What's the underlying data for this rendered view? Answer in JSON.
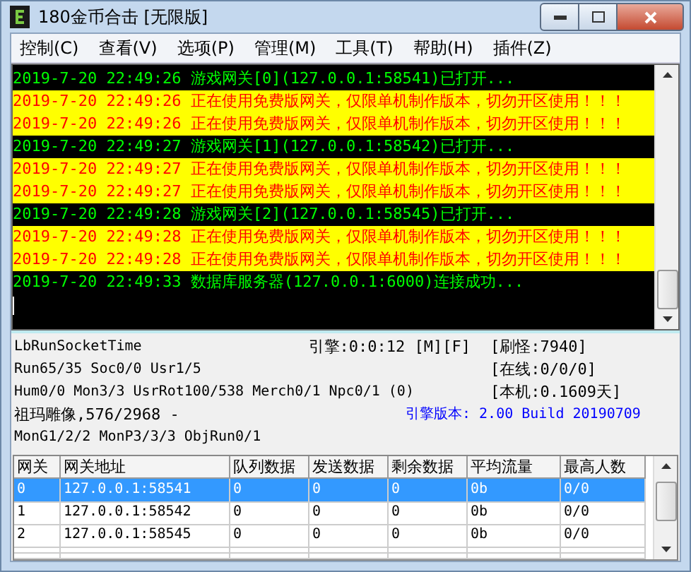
{
  "window": {
    "title": "180金币合击 [无限版]"
  },
  "menu": [
    "控制(C)",
    "查看(V)",
    "选项(P)",
    "管理(M)",
    "工具(T)",
    "帮助(H)",
    "插件(Z)"
  ],
  "log": [
    {
      "kind": "info",
      "text": "2019-7-20 22:49:26 游戏网关[0](127.0.0.1:58541)已打开..."
    },
    {
      "kind": "warning",
      "text": "2019-7-20 22:49:26 正在使用免费版网关，仅限单机制作版本，切勿开区使用！！！"
    },
    {
      "kind": "warning",
      "text": "2019-7-20 22:49:26 正在使用免费版网关，仅限单机制作版本，切勿开区使用！！！"
    },
    {
      "kind": "info",
      "text": "2019-7-20 22:49:27 游戏网关[1](127.0.0.1:58542)已打开..."
    },
    {
      "kind": "warning",
      "text": "2019-7-20 22:49:27 正在使用免费版网关，仅限单机制作版本，切勿开区使用！！！"
    },
    {
      "kind": "warning",
      "text": "2019-7-20 22:49:27 正在使用免费版网关，仅限单机制作版本，切勿开区使用！！！"
    },
    {
      "kind": "info",
      "text": "2019-7-20 22:49:28 游戏网关[2](127.0.0.1:58545)已打开..."
    },
    {
      "kind": "warning",
      "text": "2019-7-20 22:49:28 正在使用免费版网关，仅限单机制作版本，切勿开区使用！！！"
    },
    {
      "kind": "warning",
      "text": "2019-7-20 22:49:28 正在使用免费版网关，仅限单机制作版本，切勿开区使用！！！"
    },
    {
      "kind": "info",
      "text": "2019-7-20 22:49:33 数据库服务器(127.0.0.1:6000)连接成功..."
    }
  ],
  "status": {
    "left": [
      "LbRunSocketTime",
      "Run65/35 Soc0/0 Usr1/5",
      "Hum0/0 Mon3/3 UsrRot100/538 Merch0/1 Npc0/1 (0)",
      "祖玛雕像,576/2968 -",
      "MonG1/2/2 MonP3/3/3 ObjRun0/1"
    ],
    "engine_time": "引擎:0:0:12 [M][F]",
    "right": [
      "[刷怪:7940]",
      "[在线:0/0/0]",
      "[本机:0.1609天]"
    ],
    "version": "引擎版本: 2.00 Build 20190709"
  },
  "table": {
    "columns": [
      "网关",
      "网关地址",
      "队列数据",
      "发送数据",
      "剩余数据",
      "平均流量",
      "最高人数"
    ],
    "rows": [
      {
        "selected": true,
        "cells": [
          "0",
          "127.0.0.1:58541",
          "0",
          "0",
          "0",
          "0b",
          "0/0"
        ]
      },
      {
        "selected": false,
        "cells": [
          "1",
          "127.0.0.1:58542",
          "0",
          "0",
          "0",
          "0b",
          "0/0"
        ]
      },
      {
        "selected": false,
        "cells": [
          "2",
          "127.0.0.1:58545",
          "0",
          "0",
          "0",
          "0b",
          "0/0"
        ]
      }
    ]
  }
}
